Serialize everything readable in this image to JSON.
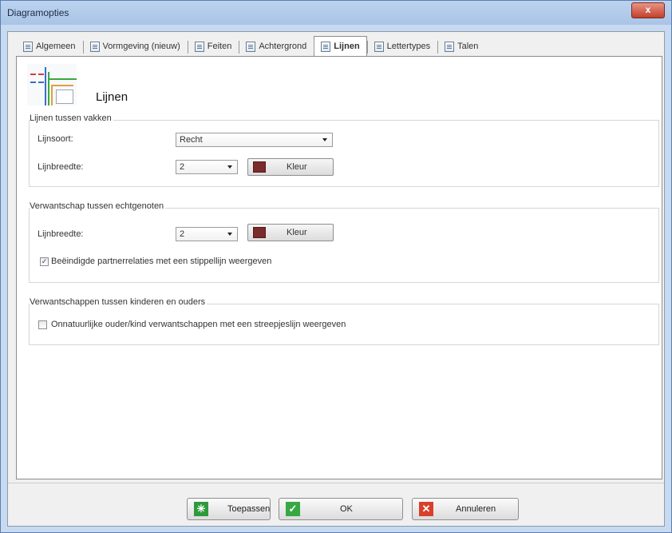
{
  "window": {
    "title": "Diagramopties",
    "close_glyph": "x"
  },
  "tabs": [
    {
      "label": "Algemeen",
      "icon": "page-icon"
    },
    {
      "label": "Vormgeving (nieuw)",
      "icon": "layout-icon"
    },
    {
      "label": "Feiten",
      "icon": "page-icon"
    },
    {
      "label": "Achtergrond",
      "icon": "background-icon"
    },
    {
      "label": "Lijnen",
      "icon": "lines-icon",
      "active": true
    },
    {
      "label": "Lettertypes",
      "icon": "font-icon"
    },
    {
      "label": "Talen",
      "icon": "page-icon"
    }
  ],
  "header": {
    "title": "Lijnen",
    "icon": "lines-diagram-icon"
  },
  "group1": {
    "legend": "Lijnen tussen vakken",
    "lijnsoort_label": "Lijnsoort:",
    "lijnsoort_value": "Recht",
    "lijnbreedte_label": "Lijnbreedte:",
    "lijnbreedte_value": "2",
    "color_button": "Kleur",
    "color": "#7a2b2b"
  },
  "group2": {
    "legend": "Verwantschap tussen echtgenoten",
    "lijnbreedte_label": "Lijnbreedte:",
    "lijnbreedte_value": "2",
    "color_button": "Kleur",
    "color": "#7a2b2b",
    "checkbox_label": "Beëindigde partnerrelaties met een stippellijn weergeven",
    "checkbox_checked": true
  },
  "group3": {
    "legend": "Verwantschappen tussen kinderen en ouders",
    "checkbox_label": "Onnatuurlijke ouder/kind verwantschappen met een streepjeslijn weergeven",
    "checkbox_checked": false
  },
  "buttons": {
    "apply": "Toepassen",
    "ok": "OK",
    "cancel": "Annuleren",
    "check_glyph": "✓",
    "cancel_glyph": "✕",
    "apply_glyph": "✳"
  }
}
